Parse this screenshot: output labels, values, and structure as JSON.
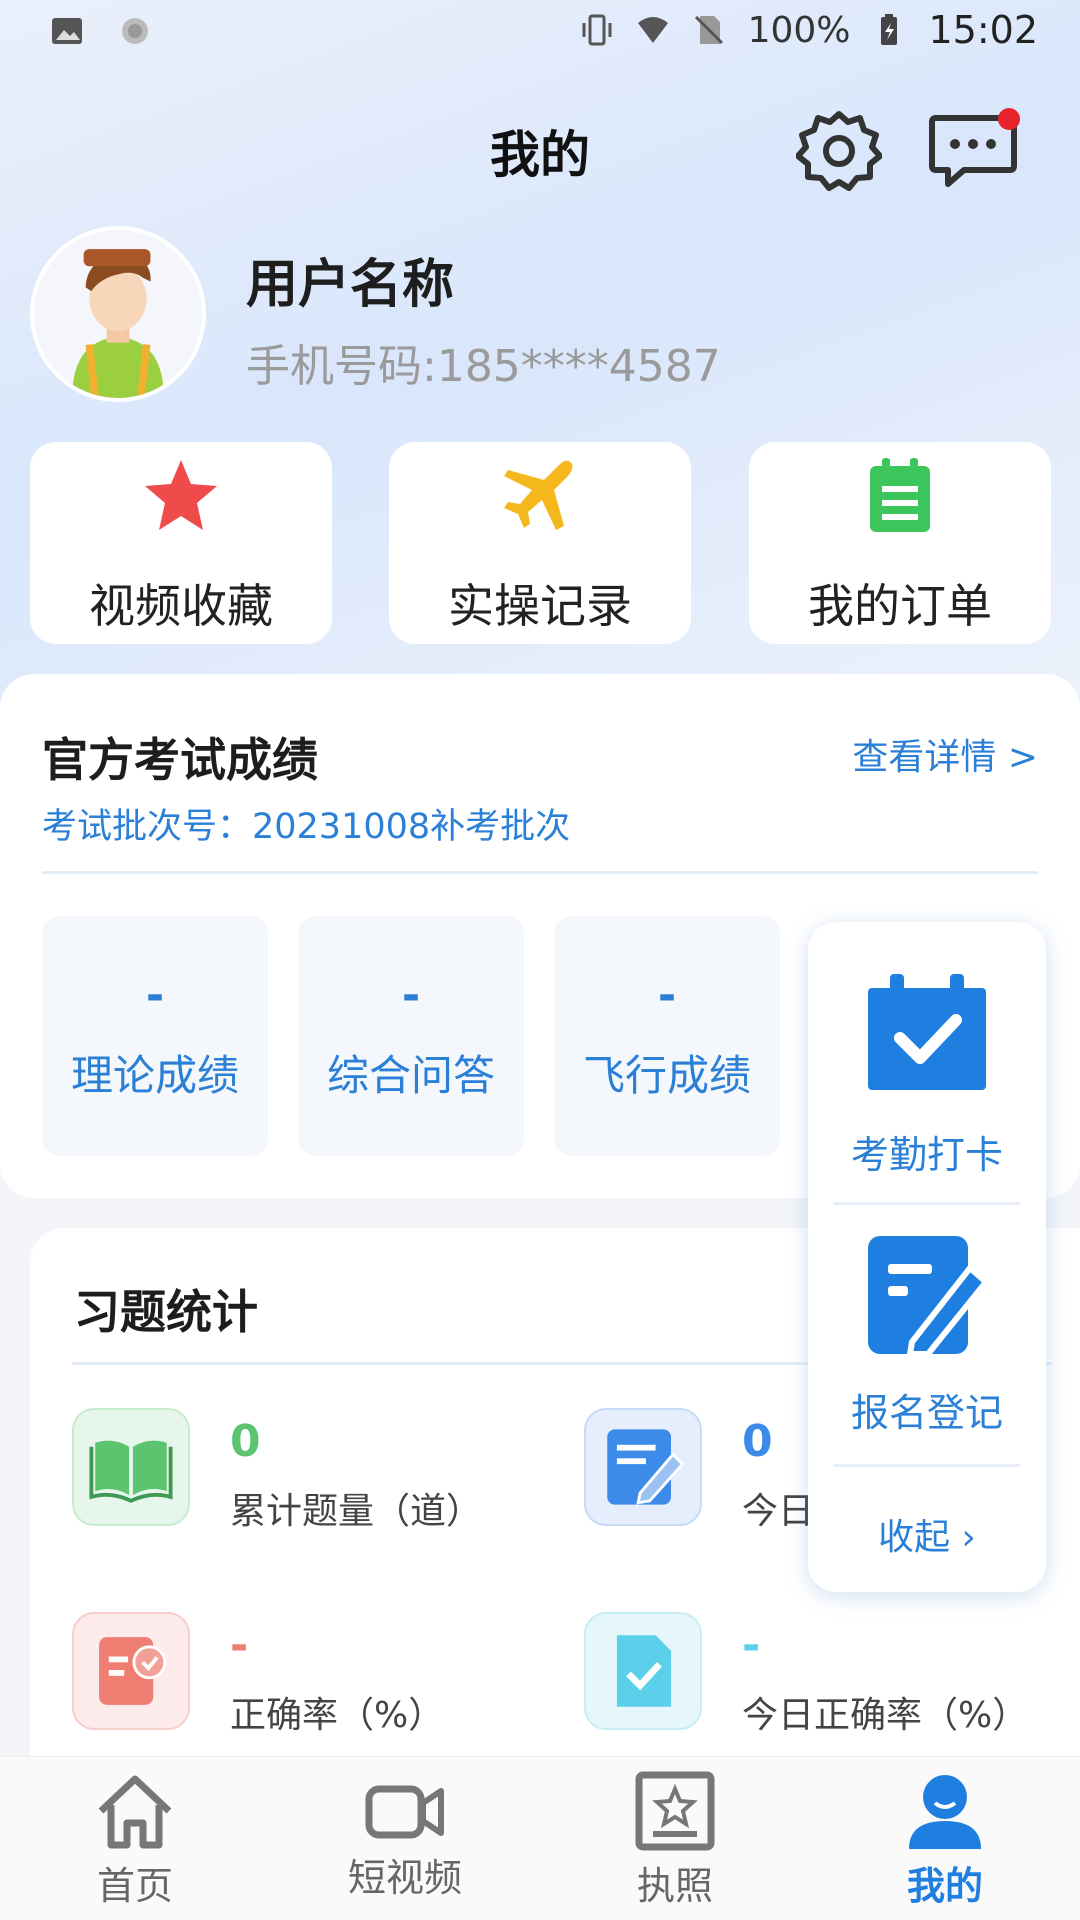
{
  "status_bar": {
    "battery": "100%",
    "time": "15:02"
  },
  "header": {
    "title": "我的"
  },
  "profile": {
    "username": "用户名称",
    "phone": "手机号码:185****4587"
  },
  "quick_actions": [
    {
      "label": "视频收藏",
      "icon": "star-icon",
      "color": "#ef4b4b"
    },
    {
      "label": "实操记录",
      "icon": "airplane-icon",
      "color": "#f5b81c"
    },
    {
      "label": "我的订单",
      "icon": "clipboard-icon",
      "color": "#3cc55b"
    }
  ],
  "exam": {
    "title": "官方考试成绩",
    "detail_link": "查看详情 >",
    "batch": "考试批次号：20231008补考批次",
    "scores": [
      {
        "value": "-",
        "label": "理论成绩"
      },
      {
        "value": "-",
        "label": "综合问答"
      },
      {
        "value": "-",
        "label": "飞行成绩"
      }
    ]
  },
  "stats": {
    "title": "习题统计",
    "items": [
      {
        "value": "0",
        "label": "累计题量（道）",
        "icon": "book-icon",
        "color": "#5cc46e"
      },
      {
        "value": "0",
        "label": "今日",
        "icon": "edit-note-icon",
        "color": "#3d8be8"
      },
      {
        "value": "-",
        "label": "正确率（%）",
        "icon": "report-check-icon",
        "color": "#ee7e72"
      },
      {
        "value": "-",
        "label": "今日正确率（%）",
        "icon": "doc-check-icon",
        "color": "#5ad0ea"
      }
    ]
  },
  "float_panel": {
    "items": [
      {
        "label": "考勤打卡",
        "icon": "calendar-check-icon"
      },
      {
        "label": "报名登记",
        "icon": "signup-edit-icon"
      }
    ],
    "collapse": "收起 ›"
  },
  "bottom_nav": [
    {
      "label": "首页",
      "icon": "home-icon"
    },
    {
      "label": "短视频",
      "icon": "video-icon"
    },
    {
      "label": "执照",
      "icon": "license-icon"
    },
    {
      "label": "我的",
      "icon": "user-icon",
      "active_color": "#1f7fe0"
    }
  ]
}
